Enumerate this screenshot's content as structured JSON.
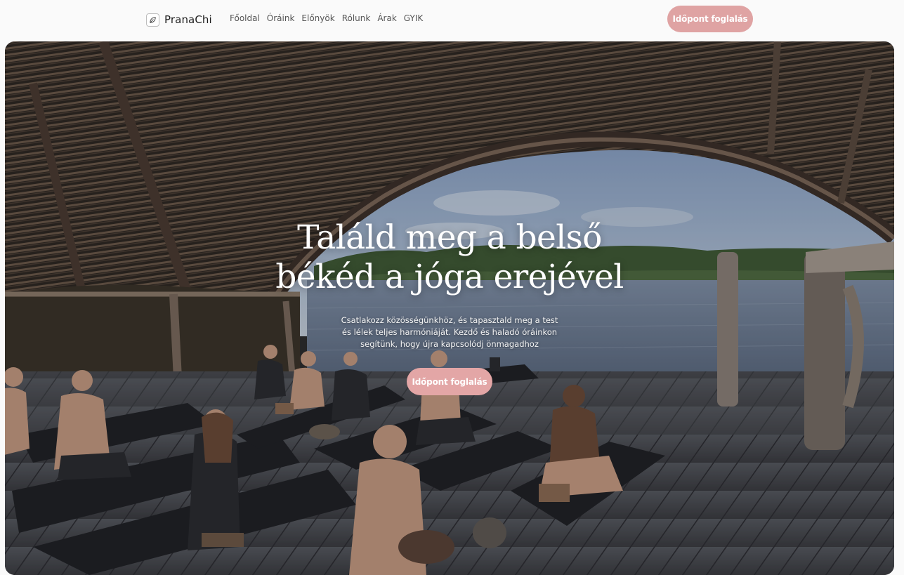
{
  "brand": {
    "name": "PranaChi",
    "icon": "leaf-icon"
  },
  "nav": {
    "items": [
      {
        "label": "Főoldal"
      },
      {
        "label": "Óráink"
      },
      {
        "label": "Előnyök"
      },
      {
        "label": "Rólunk"
      },
      {
        "label": "Árak"
      },
      {
        "label": "GYIK"
      }
    ],
    "cta_label": "Időpont foglalás"
  },
  "hero": {
    "title_line1": "Találd meg a belső",
    "title_line2": "békéd a jóga erejével",
    "subtitle": "Csatlakozz közösségünkhöz, és tapasztald meg a test és lélek teljes harmóniáját. Kezdő és haladó óráinkon segítünk, hogy újra kapcsolódj önmagadhoz",
    "cta_label": "Időpont foglalás",
    "image": "yoga-class-under-thatched-pavilion"
  },
  "colors": {
    "accent": "#dfa3a3",
    "background": "#fafafa",
    "text": "#1e1e1e"
  }
}
